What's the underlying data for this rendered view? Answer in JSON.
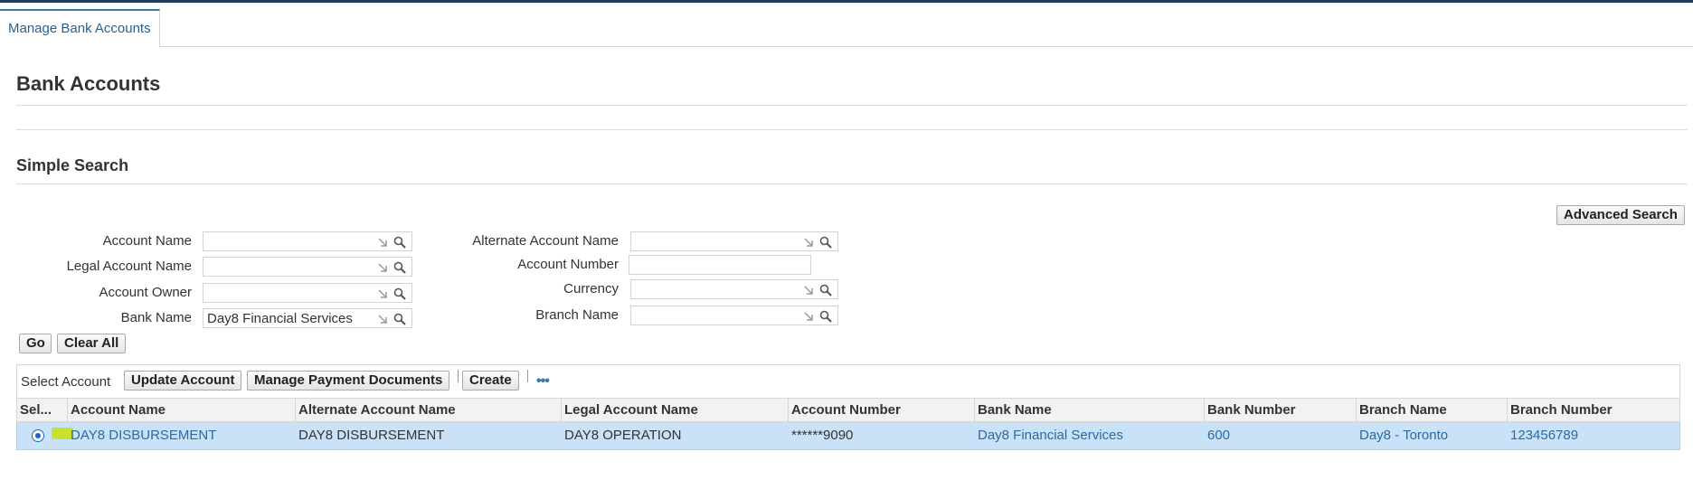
{
  "tabs": {
    "active_label": "Manage Bank Accounts"
  },
  "page": {
    "title": "Bank Accounts"
  },
  "search": {
    "section_title": "Simple Search",
    "advanced_button": "Advanced Search",
    "go_button": "Go",
    "clear_button": "Clear All",
    "fields": {
      "account_name": {
        "label": "Account Name",
        "value": ""
      },
      "legal_account_name": {
        "label": "Legal Account Name",
        "value": ""
      },
      "account_owner": {
        "label": "Account Owner",
        "value": ""
      },
      "bank_name": {
        "label": "Bank Name",
        "value": "Day8 Financial Services"
      },
      "alternate_account_name": {
        "label": "Alternate Account Name",
        "value": ""
      },
      "account_number": {
        "label": "Account Number",
        "value": ""
      },
      "currency": {
        "label": "Currency",
        "value": ""
      },
      "branch_name": {
        "label": "Branch Name",
        "value": ""
      }
    }
  },
  "toolbar": {
    "select_label": "Select Account",
    "update_button": "Update Account",
    "manage_payment_button": "Manage Payment Documents",
    "create_button": "Create"
  },
  "table": {
    "columns": [
      "Sel...",
      "Account Name",
      "Alternate Account Name",
      "Legal Account Name",
      "Account Number",
      "Bank Name",
      "Bank Number",
      "Branch Name",
      "Branch Number"
    ],
    "rows": [
      {
        "selected": true,
        "account_name": "DAY8 DISBURSEMENT",
        "alternate_account_name": "DAY8 DISBURSEMENT",
        "legal_account_name": "DAY8 OPERATION",
        "account_number": "******9090",
        "bank_name": "Day8 Financial Services",
        "bank_number": "600",
        "branch_name": "Day8 - Toronto",
        "branch_number": "123456789"
      }
    ]
  },
  "colors": {
    "accent": "#285f8e",
    "link": "#2c6aa0",
    "selected_row": "#c9e2f8",
    "header_bar": "#1f3c5c",
    "marker_highlight": "#c6e11a"
  },
  "icons": [
    "lov-arrow-icon",
    "search-icon",
    "more-options-icon",
    "radio-selected-icon"
  ]
}
